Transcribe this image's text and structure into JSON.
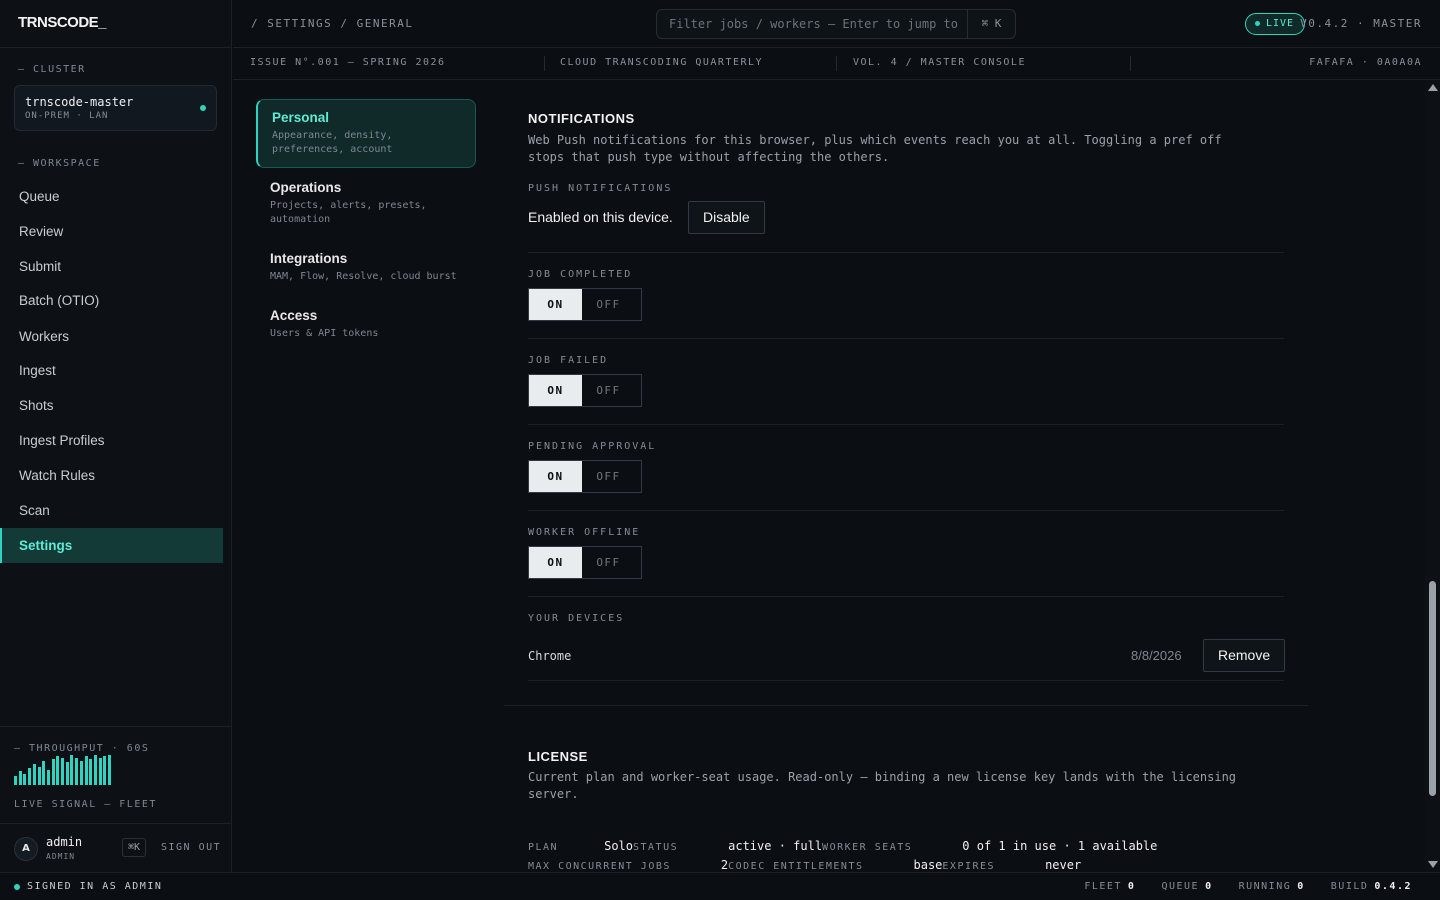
{
  "app": {
    "logo": "TRNSCODE_"
  },
  "topbar": {
    "breadcrumb": "/ SETTINGS / GENERAL",
    "search_placeholder": "Filter jobs / workers — Enter to jump to",
    "search_shortcut": "⌘ K",
    "live_label": "LIVE",
    "version": "V0.4.2 · MASTER"
  },
  "issue_strip": {
    "issue": "ISSUE N°.001 — SPRING 2026",
    "publication": "CLOUD TRANSCODING QUARTERLY",
    "volume": "VOL. 4 / MASTER CONSOLE",
    "palette": "FAFAFA · 0A0A0A"
  },
  "sidebar": {
    "cluster_label": "— CLUSTER",
    "cluster_name": "trnscode-master",
    "cluster_sub": "ON-PREM · LAN",
    "workspace_label": "— WORKSPACE",
    "items": [
      {
        "label": "Queue"
      },
      {
        "label": "Review"
      },
      {
        "label": "Submit"
      },
      {
        "label": "Batch (OTIO)"
      },
      {
        "label": "Workers"
      },
      {
        "label": "Ingest"
      },
      {
        "label": "Shots"
      },
      {
        "label": "Ingest Profiles"
      },
      {
        "label": "Watch Rules"
      },
      {
        "label": "Scan"
      },
      {
        "label": "Settings"
      }
    ],
    "throughput_label": "— THROUGHPUT · 60S",
    "throughput_bars": [
      0.3,
      0.45,
      0.35,
      0.55,
      0.7,
      0.6,
      0.8,
      0.5,
      0.85,
      0.95,
      0.9,
      0.75,
      1.0,
      0.9,
      0.8,
      0.95,
      0.85,
      1.0,
      0.9,
      0.95,
      1.0
    ],
    "live_signal": "LIVE SIGNAL — FLEET",
    "user_initial": "A",
    "user_name": "admin",
    "user_role": "ADMIN",
    "shortcut": "⌘K",
    "sign_out": "SIGN OUT"
  },
  "subnav": [
    {
      "title": "Personal",
      "desc": "Appearance, density, preferences, account"
    },
    {
      "title": "Operations",
      "desc": "Projects, alerts, presets, automation"
    },
    {
      "title": "Integrations",
      "desc": "MAM, Flow, Resolve, cloud burst"
    },
    {
      "title": "Access",
      "desc": "Users & API tokens"
    }
  ],
  "notifications": {
    "title": "NOTIFICATIONS",
    "description": "Web Push notifications for this browser, plus which events reach you at all. Toggling a pref off stops that push type without affecting the others.",
    "push_label": "PUSH NOTIFICATIONS",
    "push_status": "Enabled on this device.",
    "disable_label": "Disable",
    "on_label": "ON",
    "off_label": "OFF",
    "prefs": [
      {
        "label": "JOB COMPLETED",
        "value": "ON"
      },
      {
        "label": "JOB FAILED",
        "value": "ON"
      },
      {
        "label": "PENDING APPROVAL",
        "value": "ON"
      },
      {
        "label": "WORKER OFFLINE",
        "value": "ON"
      }
    ],
    "devices_label": "YOUR DEVICES",
    "device_name": "Chrome",
    "device_date": "8/8/2026",
    "remove_label": "Remove"
  },
  "license": {
    "title": "LICENSE",
    "description": "Current plan and worker-seat usage. Read-only — binding a new license key lands with the licensing server.",
    "plan_key": "PLAN",
    "plan_val": "Solo",
    "status_key": "STATUS",
    "status_val": "active · full",
    "seats_key": "WORKER SEATS",
    "seats_val": "0 of 1 in use · 1 available",
    "jobs_key": "MAX CONCURRENT JOBS",
    "jobs_val": "2",
    "codec_key": "CODEC ENTITLEMENTS",
    "codec_val": "base",
    "expires_key": "EXPIRES",
    "expires_val": "never"
  },
  "statusbar": {
    "signed_in": "SIGNED IN AS ADMIN",
    "fleet_key": "FLEET",
    "fleet_val": "0",
    "queue_key": "QUEUE",
    "queue_val": "0",
    "running_key": "RUNNING",
    "running_val": "0",
    "build_key": "BUILD",
    "build_val": "0.4.2"
  },
  "colors": {
    "accent": "#2dd4bf",
    "background": "#0b0e12",
    "active_bg": "#133a37"
  }
}
